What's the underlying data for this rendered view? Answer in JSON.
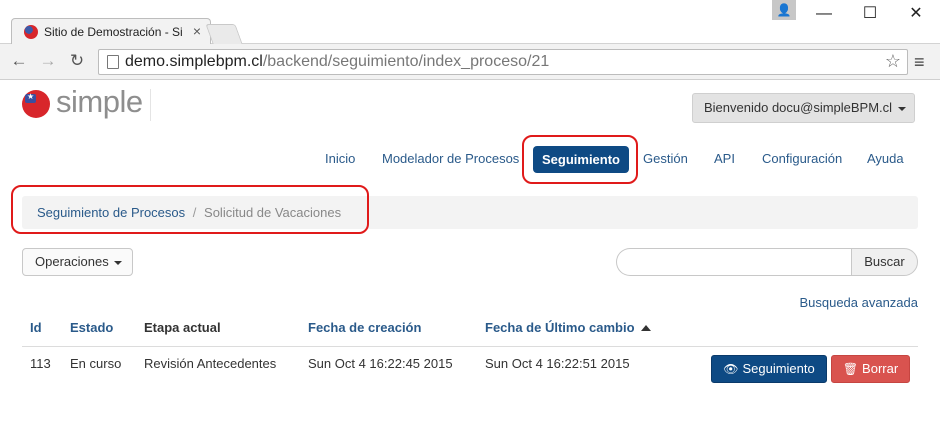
{
  "browser": {
    "tab_title": "Sitio de Demostración - Si",
    "tab_close": "×",
    "url_host": "demo.simplebpm.cl",
    "url_path": "/backend/seguimiento/index_proceso/21",
    "back_glyph": "←",
    "forward_glyph": "→",
    "reload_glyph": "↻",
    "star_glyph": "☆",
    "menu_glyph": "≡",
    "minimize_glyph": "—",
    "maximize_glyph": "☐",
    "close_glyph": "✕",
    "profile_glyph": "👤"
  },
  "header": {
    "logo_text": "simple",
    "user_label": "Bienvenido docu@simpleBPM.cl"
  },
  "nav": {
    "items": [
      "Inicio",
      "Modelador de Procesos",
      "Seguimiento",
      "Gestión",
      "API",
      "Configuración",
      "Ayuda"
    ],
    "active": "Seguimiento"
  },
  "breadcrumb": {
    "parent": "Seguimiento de Procesos",
    "separator": "/",
    "current": "Solicitud de Vacaciones"
  },
  "toolbar": {
    "operations_label": "Operaciones",
    "search_placeholder": "",
    "search_button": "Buscar",
    "advanced_search": "Busqueda avanzada"
  },
  "table": {
    "headers": [
      "Id",
      "Estado",
      "Etapa actual",
      "Fecha de creación",
      "Fecha de Último cambio"
    ],
    "sorted_column": "Fecha de Último cambio",
    "rows": [
      {
        "id": "113",
        "estado": "En curso",
        "etapa": "Revisión Antecedentes",
        "creacion": "Sun Oct 4 16:22:45 2015",
        "cambio": "Sun Oct 4 16:22:51 2015",
        "follow_label": "Seguimiento",
        "delete_label": "Borrar"
      }
    ]
  },
  "colors": {
    "primary": "#0e4a84",
    "danger": "#d9534f",
    "link": "#2a5a8a",
    "highlight_ring": "#e01a1a"
  },
  "icons": {
    "eye": "eye-icon",
    "trash": "trash-icon",
    "sort": "sort-ascending-icon",
    "favicon": "simple-favicon-icon"
  }
}
